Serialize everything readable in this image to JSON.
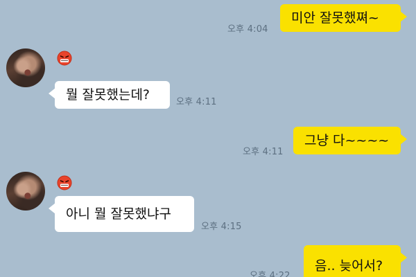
{
  "messages": [
    {
      "side": "out",
      "text": "미안 잘못했쪄~",
      "time": "오후 4:04"
    },
    {
      "side": "in",
      "text": "뭘 잘못했는데?",
      "time": "오후 4:11"
    },
    {
      "side": "out",
      "text": "그냥 다~~~~",
      "time": "오후 4:11"
    },
    {
      "side": "in",
      "text": "아니 뭘 잘못했냐구",
      "time": "오후 4:15"
    },
    {
      "side": "out",
      "text": "음.. 늦어서?",
      "time": "오후 4:22"
    }
  ],
  "profile": {
    "avatar_icon": "profile-photo",
    "emoji_icon": "angry-face-emoji"
  },
  "colors": {
    "background": "#a9bdce",
    "outgoing_bubble": "#fae100",
    "incoming_bubble": "#ffffff",
    "timestamp": "#5c6f80"
  }
}
